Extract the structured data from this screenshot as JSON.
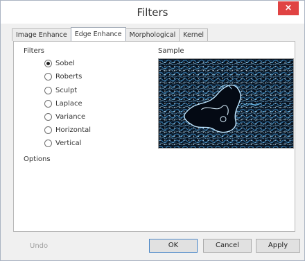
{
  "window": {
    "title": "Filters",
    "close_glyph": "×"
  },
  "tabs": [
    {
      "label": "Image Enhance",
      "active": false
    },
    {
      "label": "Edge Enhance",
      "active": true
    },
    {
      "label": "Morphological",
      "active": false
    },
    {
      "label": "Kernel",
      "active": false
    }
  ],
  "filters": {
    "group_label": "Filters",
    "options": [
      {
        "label": "Sobel",
        "checked": true
      },
      {
        "label": "Roberts",
        "checked": false
      },
      {
        "label": "Sculpt",
        "checked": false
      },
      {
        "label": "Laplace",
        "checked": false
      },
      {
        "label": "Variance",
        "checked": false
      },
      {
        "label": "Horizontal",
        "checked": false
      },
      {
        "label": "Vertical",
        "checked": false
      }
    ]
  },
  "sample": {
    "label": "Sample"
  },
  "options": {
    "label": "Options"
  },
  "footer": {
    "undo_label": "Undo",
    "ok_label": "OK",
    "cancel_label": "Cancel",
    "apply_label": "Apply"
  },
  "colors": {
    "close_button": "#e04343",
    "sample_background": "#06101c",
    "sample_edges": "#5fb4e8"
  },
  "icons": {
    "close": "close-icon"
  }
}
